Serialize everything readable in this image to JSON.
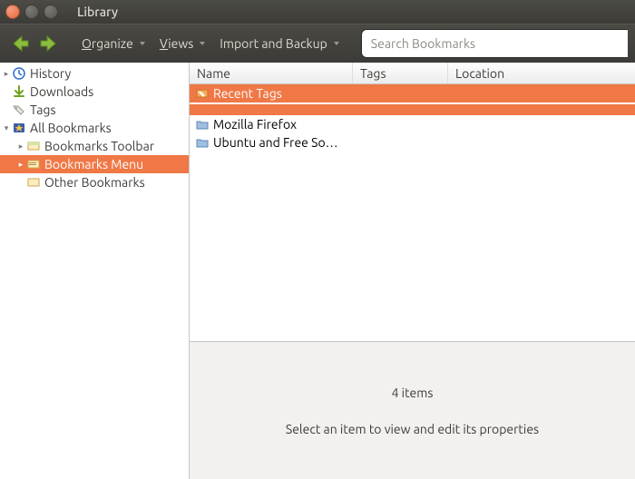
{
  "window": {
    "title": "Library"
  },
  "toolbar": {
    "organize": "Organize",
    "views": "Views",
    "import_backup": "Import and Backup"
  },
  "search": {
    "placeholder": "Search Bookmarks"
  },
  "sidebar": {
    "history": "History",
    "downloads": "Downloads",
    "tags": "Tags",
    "all_bookmarks": "All Bookmarks",
    "bookmarks_toolbar": "Bookmarks Toolbar",
    "bookmarks_menu": "Bookmarks Menu",
    "other_bookmarks": "Other Bookmarks"
  },
  "columns": {
    "name": "Name",
    "tags": "Tags",
    "location": "Location"
  },
  "rows": {
    "recent_tags": "Recent Tags",
    "mozilla_firefox": "Mozilla Firefox",
    "ubuntu_free": "Ubuntu and Free So…"
  },
  "details": {
    "count": "4 items",
    "hint": "Select an item to view and edit its properties"
  }
}
